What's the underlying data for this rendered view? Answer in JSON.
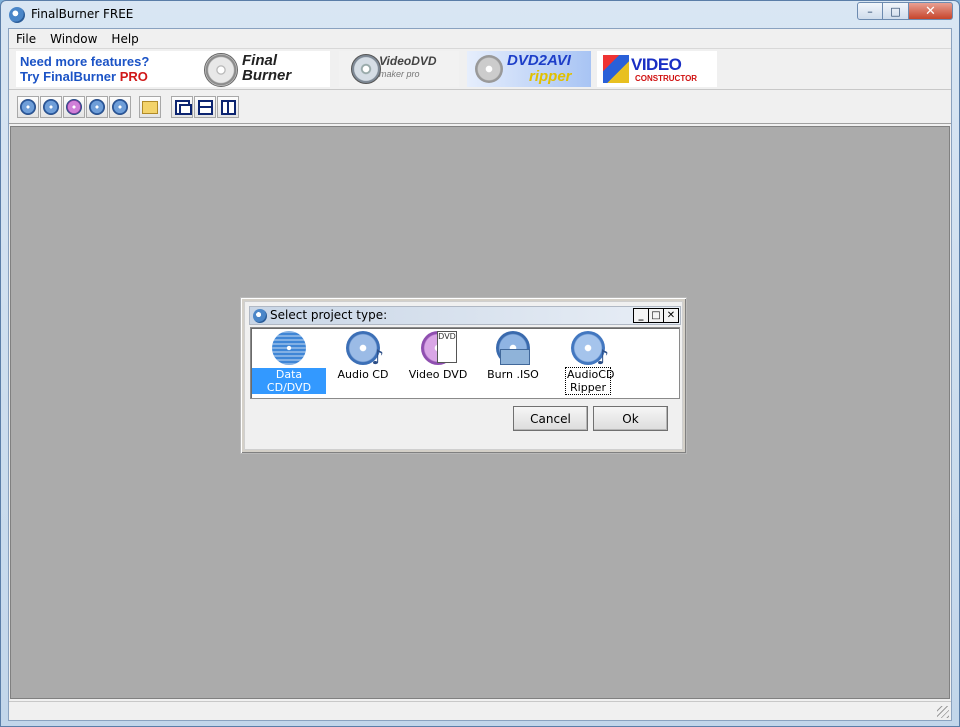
{
  "window": {
    "title": "FinalBurner FREE"
  },
  "menu": {
    "items": [
      "File",
      "Window",
      "Help"
    ]
  },
  "banners": {
    "promo_line1": "Need more features?",
    "promo_line2_prefix": "Try FinalBurner",
    "promo_line2_pro": "PRO",
    "finalburner_logo": "Final Burner",
    "videodvd_title": "VideoDVD",
    "videodvd_sub": "maker pro",
    "dvd2avi_title": "DVD2AVI",
    "dvd2avi_sub": "ripper",
    "videoconstructor_title": "VIDEO",
    "videoconstructor_sub": "CONSTRUCTOR"
  },
  "toolbar": {
    "buttons": [
      "data-cd",
      "audio-cd",
      "video-dvd",
      "burn-iso",
      "audiocd-ripper",
      "open-folder",
      "cascade",
      "tile-horizontal",
      "tile-vertical"
    ]
  },
  "dialog": {
    "title": "Select project type:",
    "project_types": [
      {
        "label": "Data CD/DVD",
        "icon": "data-disc-icon",
        "selected": true
      },
      {
        "label": "Audio CD",
        "icon": "audio-cd-icon"
      },
      {
        "label": "Video DVD",
        "icon": "video-dvd-icon"
      },
      {
        "label": "Burn .ISO",
        "icon": "burn-iso-icon"
      },
      {
        "label": "AudioCD Ripper",
        "icon": "audiocd-ripper-icon",
        "focused": true
      }
    ],
    "cancel_label": "Cancel",
    "ok_label": "Ok"
  }
}
